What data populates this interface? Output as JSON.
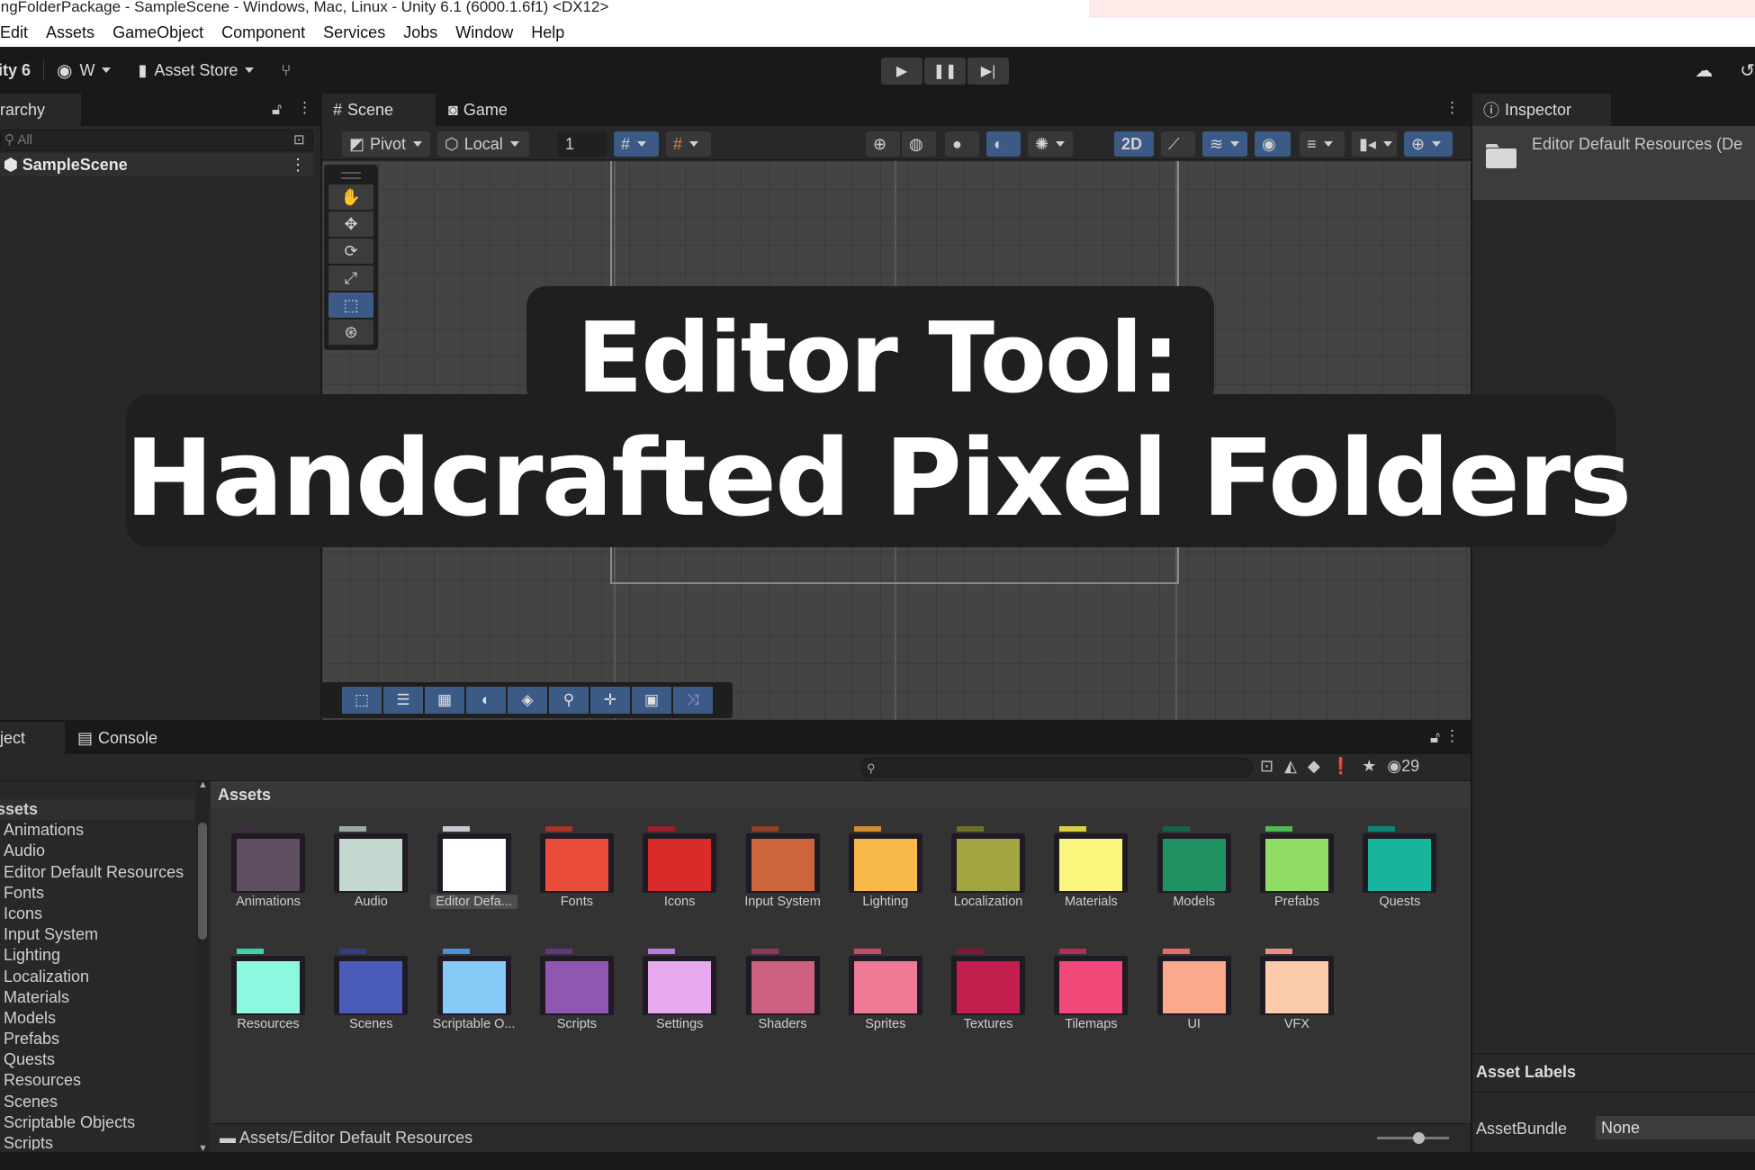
{
  "window": {
    "title": "ingFolderPackage - SampleScene - Windows, Mac, Linux - Unity 6.1 (6000.1.6f1) <DX12>"
  },
  "menu": [
    "Edit",
    "Assets",
    "GameObject",
    "Component",
    "Services",
    "Jobs",
    "Window",
    "Help"
  ],
  "toolbar": {
    "unity_label": "ity 6",
    "account_label": "W",
    "asset_store_label": "Asset Store"
  },
  "hierarchy": {
    "tab_label": "rarchy",
    "search_placeholder": "All",
    "scene_name": "SampleScene"
  },
  "scene": {
    "tabs": [
      {
        "label": "Scene"
      },
      {
        "label": "Game"
      }
    ],
    "pivot_label": "Pivot",
    "local_label": "Local",
    "grid_value": "1",
    "mode_2d_label": "2D"
  },
  "inspector": {
    "tab_label": "Inspector",
    "object_title": "Editor Default Resources (De",
    "asset_labels_heading": "Asset Labels",
    "asset_bundle_label": "AssetBundle",
    "asset_bundle_value": "None"
  },
  "project": {
    "tabs": [
      {
        "label": "ject"
      },
      {
        "label": "Console"
      }
    ],
    "hidden_count": "29",
    "tree_root": "ssets",
    "tree_items": [
      "Animations",
      "Audio",
      "Editor Default Resources",
      "Fonts",
      "Icons",
      "Input System",
      "Lighting",
      "Localization",
      "Materials",
      "Models",
      "Prefabs",
      "Quests",
      "Resources",
      "Scenes",
      "Scriptable Objects",
      "Scripts"
    ],
    "grid_heading": "Assets",
    "status_path": "Assets/Editor Default Resources",
    "folders": [
      {
        "label": "Animations",
        "color": "#5f4e5f",
        "tab": "#3d2f3f"
      },
      {
        "label": "Audio",
        "color": "#c5d8cf",
        "tab": "#9ea9a4"
      },
      {
        "label": "Editor Defa...",
        "color": "#ffffff",
        "tab": "#c8c8d0"
      },
      {
        "label": "Fonts",
        "color": "#ea4e3a",
        "tab": "#a93328"
      },
      {
        "label": "Icons",
        "color": "#da2b2b",
        "tab": "#9b1f2a"
      },
      {
        "label": "Input System",
        "color": "#cc663a",
        "tab": "#8f4025"
      },
      {
        "label": "Lighting",
        "color": "#f7b94a",
        "tab": "#d38d32"
      },
      {
        "label": "Localization",
        "color": "#a2a540",
        "tab": "#6f7128"
      },
      {
        "label": "Materials",
        "color": "#faf67e",
        "tab": "#d8d243"
      },
      {
        "label": "Models",
        "color": "#209161",
        "tab": "#176445"
      },
      {
        "label": "Prefabs",
        "color": "#92dd65",
        "tab": "#4fba53"
      },
      {
        "label": "Quests",
        "color": "#16b59c",
        "tab": "#0f8475"
      },
      {
        "label": "Resources",
        "color": "#8ef7df",
        "tab": "#3fd1a8"
      },
      {
        "label": "Scenes",
        "color": "#4a5bba",
        "tab": "#323d86"
      },
      {
        "label": "Scriptable O...",
        "color": "#87caf7",
        "tab": "#4f8ed8"
      },
      {
        "label": "Scripts",
        "color": "#8f57b0",
        "tab": "#5e3980"
      },
      {
        "label": "Settings",
        "color": "#e8aaee",
        "tab": "#b77ad9"
      },
      {
        "label": "Shaders",
        "color": "#cf6180",
        "tab": "#8d3a58"
      },
      {
        "label": "Sprites",
        "color": "#ef7a96",
        "tab": "#c04c6a"
      },
      {
        "label": "Textures",
        "color": "#c21f4f",
        "tab": "#861638"
      },
      {
        "label": "Tilemaps",
        "color": "#f0497a",
        "tab": "#b22d58"
      },
      {
        "label": "UI",
        "color": "#fba98b",
        "tab": "#e66e68"
      },
      {
        "label": "VFX",
        "color": "#fccbab",
        "tab": "#eb8e84"
      }
    ]
  },
  "headline": {
    "line1": "Editor Tool:",
    "line2": "Handcrafted Pixel Folders"
  }
}
